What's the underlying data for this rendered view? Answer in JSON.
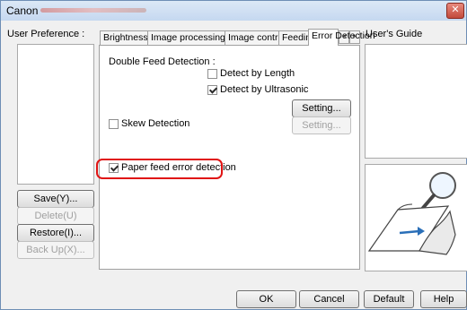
{
  "window": {
    "title_prefix": "Canon",
    "close_label": "✕"
  },
  "left_panel": {
    "label": "User Preference :",
    "buttons": {
      "save": "Save(Y)...",
      "delete": "Delete(U)",
      "restore": "Restore(I)...",
      "backup": "Back Up(X)..."
    }
  },
  "tabs": [
    {
      "label": "Brightness"
    },
    {
      "label": "Image processing"
    },
    {
      "label": "Image control"
    },
    {
      "label": "Feeding"
    },
    {
      "label": "Error Detection"
    }
  ],
  "tab_scroll": {
    "left": "◄",
    "right": "►"
  },
  "error_detection": {
    "double_feed_label": "Double Feed Detection :",
    "detect_by_length": {
      "label": "Detect by Length",
      "checked": false
    },
    "detect_by_ultrasonic": {
      "label": "Detect by Ultrasonic",
      "checked": true
    },
    "setting_button_1": "Setting...",
    "skew_detection": {
      "label": "Skew Detection",
      "checked": false
    },
    "setting_button_2": "Setting...",
    "paper_feed_error": {
      "label": "Paper feed error detection",
      "checked": true
    }
  },
  "right_panel": {
    "label": "User's Guide"
  },
  "bottom_buttons": {
    "ok": "OK",
    "cancel": "Cancel",
    "default": "Default",
    "help": "Help"
  }
}
